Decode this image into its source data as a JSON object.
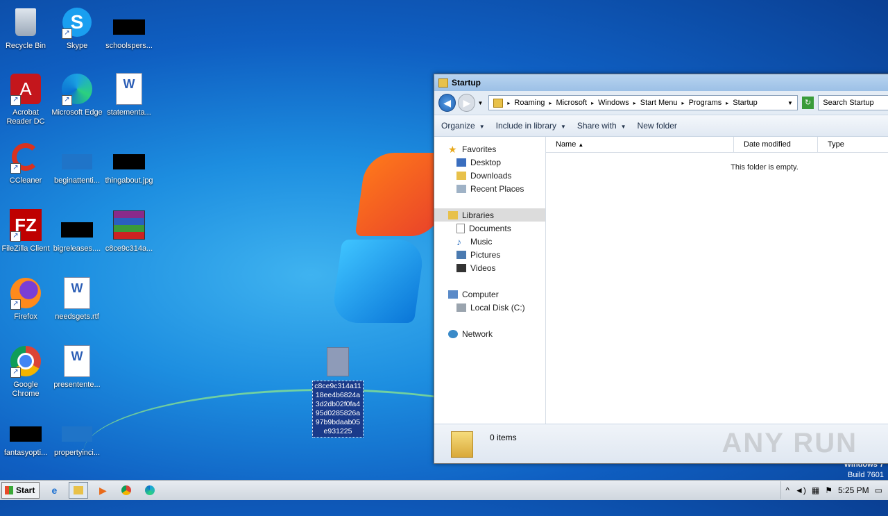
{
  "desktop": {
    "icons": [
      {
        "label": "Recycle Bin",
        "icon": "recycle-bin-icon"
      },
      {
        "label": "Skype",
        "icon": "skype-icon"
      },
      {
        "label": "schoolspers...",
        "icon": "redacted-thumbnail"
      },
      {
        "label": "Acrobat Reader DC",
        "icon": "acrobat-icon"
      },
      {
        "label": "Microsoft Edge",
        "icon": "edge-icon"
      },
      {
        "label": "statementa...",
        "icon": "word-doc-icon"
      },
      {
        "label": "CCleaner",
        "icon": "ccleaner-icon"
      },
      {
        "label": "beginattenti...",
        "icon": "blue-file-icon"
      },
      {
        "label": "thingabout.jpg",
        "icon": "redacted-thumbnail"
      },
      {
        "label": "FileZilla Client",
        "icon": "filezilla-icon"
      },
      {
        "label": "bigreleases....",
        "icon": "redacted-thumbnail"
      },
      {
        "label": "c8ce9c314a...",
        "icon": "winrar-icon"
      },
      {
        "label": "Firefox",
        "icon": "firefox-icon"
      },
      {
        "label": "needsgets.rtf",
        "icon": "word-doc-icon"
      },
      {
        "label": "Google Chrome",
        "icon": "chrome-icon"
      },
      {
        "label": "presentente...",
        "icon": "word-doc-icon"
      },
      {
        "label": "fantasyopti...",
        "icon": "redacted-thumbnail"
      },
      {
        "label": "propertyinci...",
        "icon": "blue-file-icon"
      }
    ],
    "selected_file": "c8ce9c314a1118ee4b6824a3d2db02f0fa495d0285826a97b9bdaab05e931225",
    "os_info": {
      "line1": "Windows 7",
      "line2": "Build 7601"
    }
  },
  "explorer": {
    "title": "Startup",
    "breadcrumb": [
      "Roaming",
      "Microsoft",
      "Windows",
      "Start Menu",
      "Programs",
      "Startup"
    ],
    "search_placeholder": "Search Startup",
    "commands": [
      "Organize",
      "Include in library",
      "Share with",
      "New folder"
    ],
    "nav": {
      "favorites": "Favorites",
      "desktop": "Desktop",
      "downloads": "Downloads",
      "recent": "Recent Places",
      "libraries": "Libraries",
      "documents": "Documents",
      "music": "Music",
      "pictures": "Pictures",
      "videos": "Videos",
      "computer": "Computer",
      "local_disk": "Local Disk (C:)",
      "network": "Network"
    },
    "columns": [
      "Name",
      "Date modified",
      "Type"
    ],
    "empty_message": "This folder is empty.",
    "item_count": "0 items",
    "watermark": "ANY RUN"
  },
  "taskbar": {
    "start_label": "Start",
    "clock": "5:25 PM"
  },
  "colors": {
    "selection": "#1a3a8a",
    "titlebar": "#b8d4f0"
  }
}
